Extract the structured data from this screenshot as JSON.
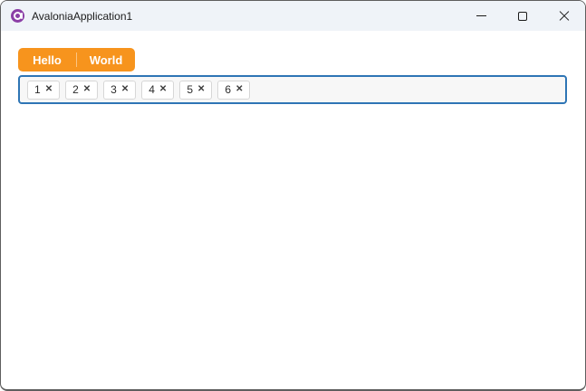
{
  "colors": {
    "accent_orange": "#F7941D",
    "focus_border_blue": "#2E75B5",
    "logo_purple": "#8B3FA6",
    "titlebar_bg": "#EFF3F8"
  },
  "title_bar": {
    "app_icon": "avalonia-logo-icon",
    "title": "AvaloniaApplication1",
    "buttons": [
      {
        "name": "minimize",
        "icon": "minimize-icon"
      },
      {
        "name": "maximize",
        "icon": "maximize-icon"
      },
      {
        "name": "close",
        "icon": "close-icon"
      }
    ]
  },
  "toolbar": {
    "split_button": {
      "left_label": "Hello",
      "right_label": "World"
    }
  },
  "tag_box": {
    "chips": [
      {
        "label": "1"
      },
      {
        "label": "2"
      },
      {
        "label": "3"
      },
      {
        "label": "4"
      },
      {
        "label": "5"
      },
      {
        "label": "6"
      }
    ],
    "remove_glyph": "✕"
  }
}
